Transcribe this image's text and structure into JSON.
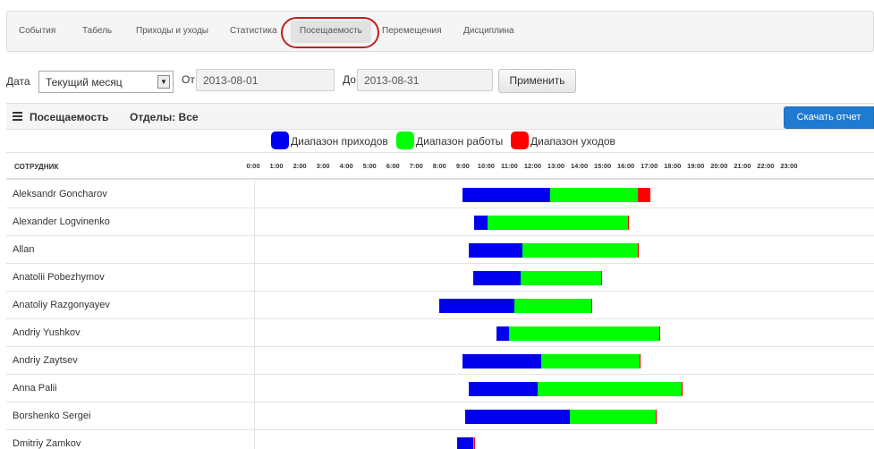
{
  "nav": {
    "items": [
      "События",
      "Табель",
      "Приходы и уходы",
      "Статистика",
      "Посещаемость",
      "Перемещения",
      "Дисциплина"
    ],
    "active": "Посещаемость"
  },
  "filter": {
    "date_label": "Дата",
    "date_value": "Текущий месяц",
    "from_label": "От",
    "from_value": "2013-08-01",
    "to_label": "До",
    "to_value": "2013-08-31",
    "apply_label": "Применить"
  },
  "panel": {
    "title": "Посещаемость",
    "departments": "Отделы: Все",
    "download_label": "Скачать отчет"
  },
  "legend": [
    {
      "label": "Диапазон приходов",
      "color": "#0000ee"
    },
    {
      "label": "Диапазон работы",
      "color": "#00ff00"
    },
    {
      "label": "Диапазон уходов",
      "color": "#ff0000"
    }
  ],
  "table": {
    "col_employee": "СОТРУДНИК",
    "hours": [
      "0:00",
      "1:00",
      "2:00",
      "3:00",
      "4:00",
      "5:00",
      "6:00",
      "7:00",
      "8:00",
      "9:00",
      "10:00",
      "11:00",
      "12:00",
      "13:00",
      "14:00",
      "15:00",
      "16:00",
      "17:00",
      "18:00",
      "19:00",
      "20:00",
      "21:00",
      "22:00",
      "23:00"
    ],
    "rows": [
      {
        "name": "Aleksandr Goncharov",
        "arrival": [
          9.0,
          12.75
        ],
        "departure": [
          16.5,
          17.05
        ]
      },
      {
        "name": "Alexander Logvinenko",
        "arrival": [
          9.5,
          10.05
        ],
        "departure": [
          16.1,
          16.12
        ]
      },
      {
        "name": "Allan",
        "arrival": [
          9.25,
          11.55
        ],
        "departure": [
          16.5,
          16.52
        ]
      },
      {
        "name": "Anatolii Pobezhymov",
        "arrival": [
          9.45,
          11.5
        ],
        "departure": [
          14.95,
          14.97
        ]
      },
      {
        "name": "Anatoliy Razgonyayev",
        "arrival": [
          8.0,
          11.2
        ],
        "departure": [
          14.5,
          14.52
        ]
      },
      {
        "name": "Andriy Yushkov",
        "arrival": [
          10.45,
          11.0
        ],
        "departure": [
          17.45,
          17.47
        ]
      },
      {
        "name": "Andriy Zaytsev",
        "arrival": [
          9.0,
          12.35
        ],
        "departure": [
          16.6,
          16.62
        ]
      },
      {
        "name": "Anna Palii",
        "arrival": [
          9.25,
          12.2
        ],
        "departure": [
          18.4,
          18.42
        ]
      },
      {
        "name": "Borshenko Sergei",
        "arrival": [
          9.1,
          13.6
        ],
        "departure": [
          17.3,
          17.32
        ]
      },
      {
        "name": "Dmitriy Zamkov",
        "arrival": [
          8.75,
          9.45
        ],
        "departure": [
          9.5,
          9.52
        ]
      }
    ]
  }
}
